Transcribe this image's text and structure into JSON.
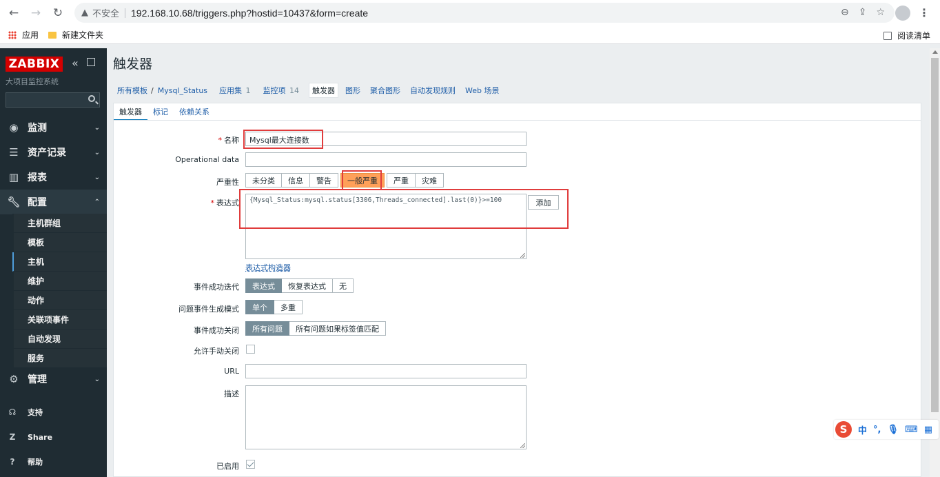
{
  "browser": {
    "insecure_label": "不安全",
    "url": "192.168.10.68/triggers.php?hostid=10437&form=create",
    "bookmarks": [
      "应用",
      "新建文件夹"
    ],
    "reading_list": "阅读清单"
  },
  "sidebar": {
    "logo": "ZABBIX",
    "server_name": "大项目监控系统",
    "search_placeholder": "",
    "sections": [
      {
        "label": "监测",
        "icon": "eye-icon"
      },
      {
        "label": "资产记录",
        "icon": "list-icon"
      },
      {
        "label": "报表",
        "icon": "bar-chart-icon"
      },
      {
        "label": "配置",
        "icon": "wrench-icon"
      },
      {
        "label": "管理",
        "icon": "gear-icon"
      }
    ],
    "config_items": [
      "主机群组",
      "模板",
      "主机",
      "维护",
      "动作",
      "关联项事件",
      "自动发现",
      "服务"
    ],
    "bottom": [
      {
        "label": "支持",
        "icon": "headset-icon"
      },
      {
        "label": "Share",
        "icon": "share-icon"
      },
      {
        "label": "帮助",
        "icon": "help-icon"
      }
    ]
  },
  "page": {
    "title": "触发器",
    "breadcrumb": {
      "all": "所有模板",
      "host": "Mysql_Status"
    },
    "tabs": [
      {
        "label": "应用集",
        "badge": "1"
      },
      {
        "label": "监控项",
        "badge": "14"
      },
      {
        "label": "触发器",
        "badge": ""
      },
      {
        "label": "图形",
        "badge": ""
      },
      {
        "label": "聚合图形",
        "badge": ""
      },
      {
        "label": "自动发现规则",
        "badge": ""
      },
      {
        "label": "Web 场景",
        "badge": ""
      }
    ]
  },
  "form": {
    "tabs": [
      "触发器",
      "标记",
      "依赖关系"
    ],
    "name_label": "名称",
    "name_value": "Mysql最大连接数",
    "opdata_label": "Operational data",
    "opdata_value": "",
    "severity_label": "严重性",
    "severity_options": [
      "未分类",
      "信息",
      "警告",
      "一般严重",
      "严重",
      "灾难"
    ],
    "severity_selected": "一般严重",
    "expression_label": "表达式",
    "expression_value": "{Mysql_Status:mysql.status[3306,Threads_connected].last(0)}>=100",
    "add_button": "添加",
    "expression_constructor": "表达式构造器",
    "ok_event_gen_label": "事件成功迭代",
    "ok_event_gen_options": [
      "表达式",
      "恢复表达式",
      "无"
    ],
    "problem_mode_label": "问题事件生成模式",
    "problem_mode_options": [
      "单个",
      "多重"
    ],
    "ok_close_label": "事件成功关闭",
    "ok_close_options": [
      "所有问题",
      "所有问题如果标签值匹配"
    ],
    "manual_close_label": "允许手动关闭",
    "manual_close_checked": false,
    "url_label": "URL",
    "url_value": "",
    "desc_label": "描述",
    "desc_value": "",
    "enabled_label": "已启用",
    "enabled_checked": true
  },
  "ime": {
    "logo": "S",
    "mode": "中",
    "punct": "°,"
  }
}
